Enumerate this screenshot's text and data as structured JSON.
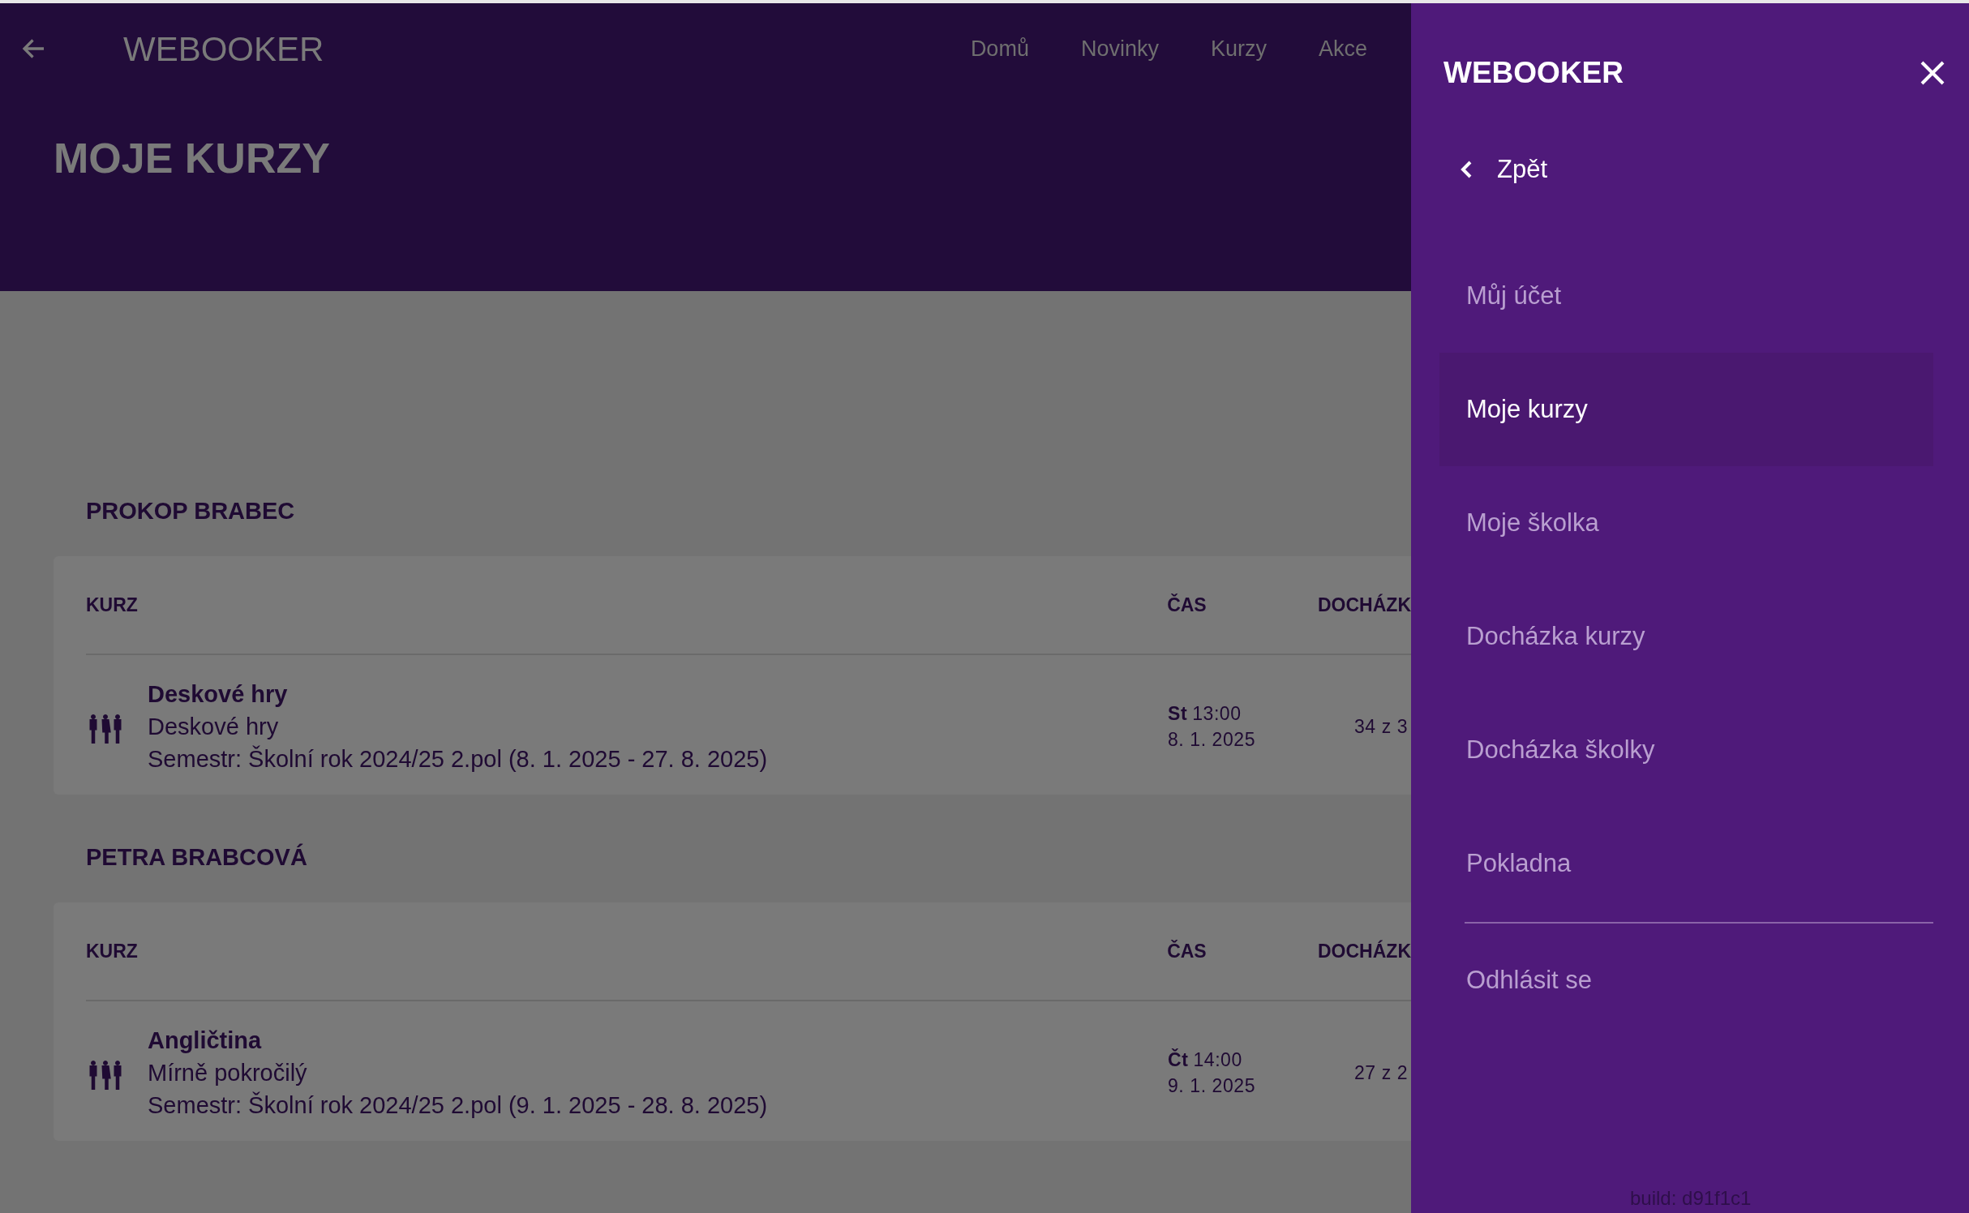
{
  "topbar": {
    "title": "WEBOOKER",
    "nav": [
      "Domů",
      "Novinky",
      "Kurzy",
      "Akce"
    ]
  },
  "page_title": "MOJE KURZY",
  "sections": [
    {
      "name": "PROKOP BRABEC",
      "columns": [
        "KURZ",
        "ČAS",
        "DOCHÁZK"
      ],
      "rows": [
        {
          "title": "Deskové hry",
          "subtitle": "Deskové hry",
          "semester": "Semestr: Školní rok 2024/25 2.pol (8. 1. 2025 - 27. 8. 2025)",
          "day": "St",
          "time": "13:00",
          "date": "8. 1. 2025",
          "attendance": "34 z 3"
        }
      ]
    },
    {
      "name": "PETRA BRABCOVÁ",
      "columns": [
        "KURZ",
        "ČAS",
        "DOCHÁZK"
      ],
      "rows": [
        {
          "title": "Angličtina",
          "subtitle": "Mírně pokročilý",
          "semester": "Semestr: Školní rok 2024/25 2.pol (9. 1. 2025 - 28. 8. 2025)",
          "day": "Čt",
          "time": "14:00",
          "date": "9. 1. 2025",
          "attendance": "27 z 2"
        }
      ]
    }
  ],
  "drawer": {
    "title": "WEBOOKER",
    "back": "Zpět",
    "items": [
      {
        "label": "Můj účet",
        "selected": false
      },
      {
        "label": "Moje kurzy",
        "selected": true
      },
      {
        "label": "Moje školka",
        "selected": false
      },
      {
        "label": "Docházka kurzy",
        "selected": false
      },
      {
        "label": "Docházka školky",
        "selected": false
      },
      {
        "label": "Pokladna",
        "selected": false
      }
    ],
    "logout": "Odhlásit se",
    "build": "build: d91f1c1"
  }
}
